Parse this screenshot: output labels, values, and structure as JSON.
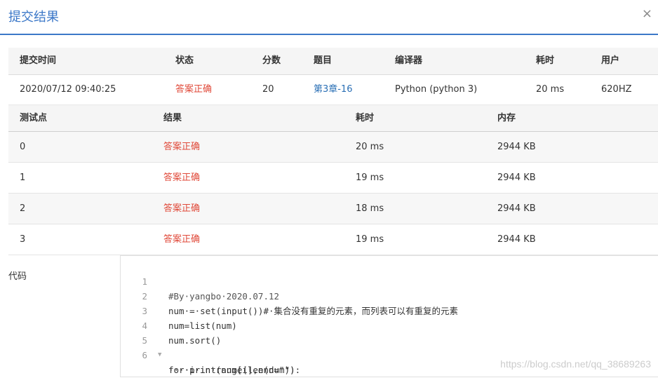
{
  "dialog": {
    "title": "提交结果",
    "close_symbol": "×"
  },
  "summary": {
    "headers": [
      "提交时间",
      "状态",
      "分数",
      "题目",
      "编译器",
      "耗时",
      "用户"
    ],
    "row": {
      "time": "2020/07/12 09:40:25",
      "status": "答案正确",
      "score": "20",
      "problem": "第3章-16",
      "compiler": "Python (python 3)",
      "elapsed": "20 ms",
      "user": "620HZ"
    }
  },
  "testpoints": {
    "headers": [
      "测试点",
      "结果",
      "耗时",
      "内存"
    ],
    "rows": [
      {
        "id": "0",
        "result": "答案正确",
        "time": "20 ms",
        "memory": "2944 KB"
      },
      {
        "id": "1",
        "result": "答案正确",
        "time": "19 ms",
        "memory": "2944 KB"
      },
      {
        "id": "2",
        "result": "答案正确",
        "time": "18 ms",
        "memory": "2944 KB"
      },
      {
        "id": "3",
        "result": "答案正确",
        "time": "19 ms",
        "memory": "2944 KB"
      }
    ]
  },
  "code": {
    "label": "代码",
    "lines": [
      {
        "n": "1",
        "text": "#By·yangbo·2020.07.12"
      },
      {
        "n": "2",
        "text": "num·=·set(input())#·集合没有重复的元素，而列表可以有重复的元素"
      },
      {
        "n": "3",
        "text": "num=list(num)"
      },
      {
        "n": "4",
        "text": "num.sort()"
      },
      {
        "n": "5",
        "text": "for·i·in·range(len(num)):"
      },
      {
        "n": "6",
        "text": "····print(num[i],end=\"\")"
      }
    ]
  },
  "watermark": "https://blog.csdn.net/qq_38689263",
  "colors": {
    "accent": "#3c78c8",
    "accepted": "#e04a3a",
    "link": "#2a6fb5"
  }
}
